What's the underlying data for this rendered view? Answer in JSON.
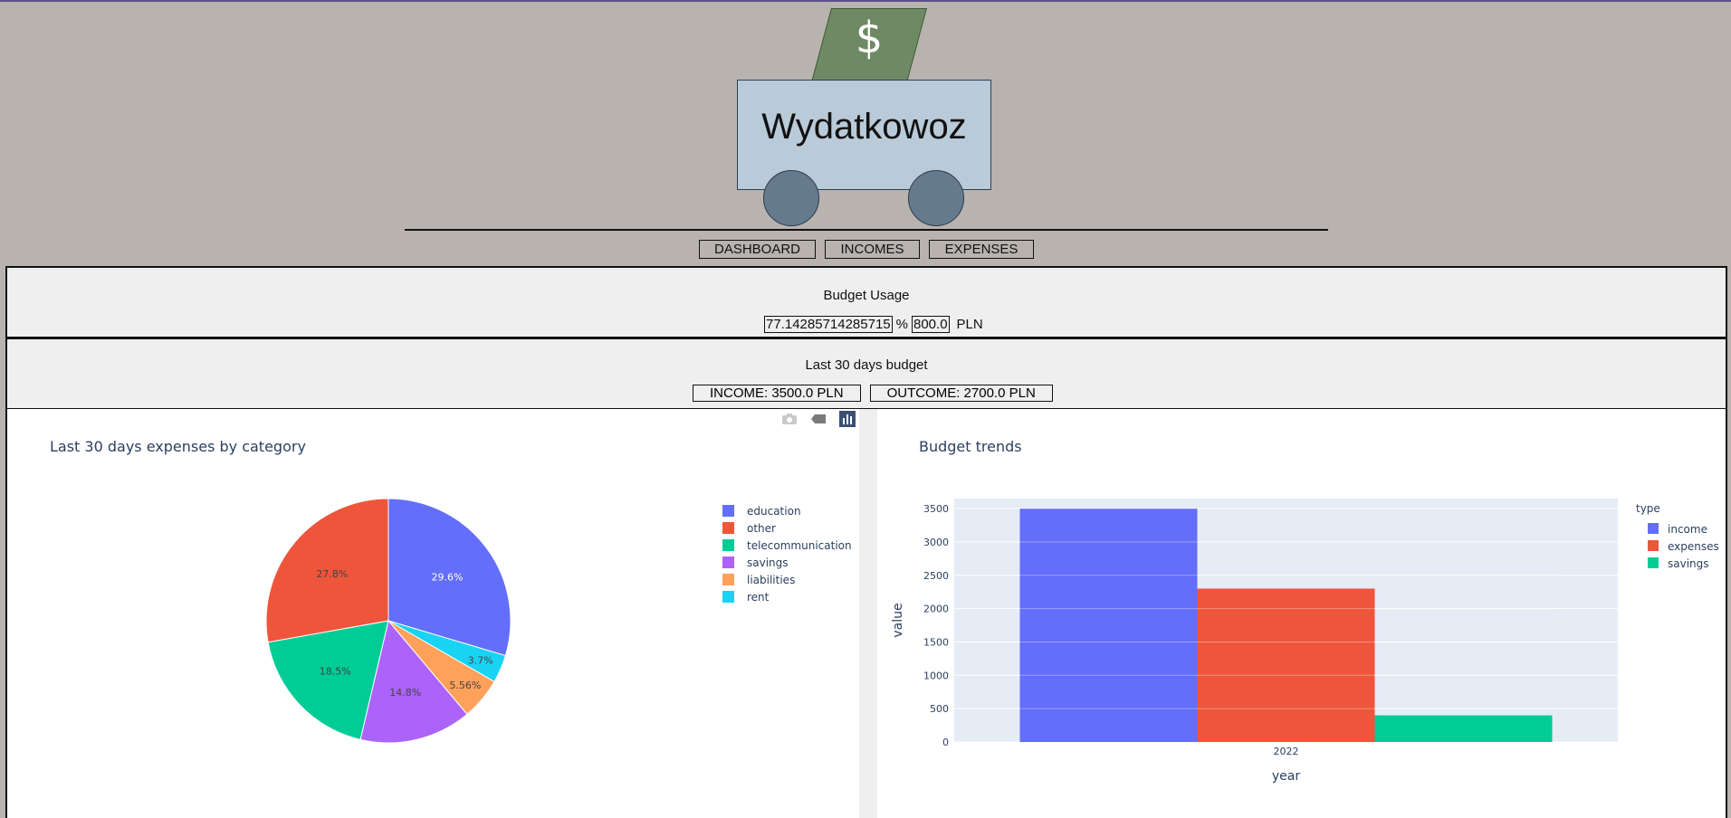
{
  "app": {
    "title": "Wydatkowoz",
    "logo_symbol": "$"
  },
  "nav": {
    "dashboard": "DASHBOARD",
    "incomes": "INCOMES",
    "expenses": "EXPENSES"
  },
  "budget_usage": {
    "title": "Budget Usage",
    "percent": "77.14285714285715",
    "percent_unit": "%",
    "amount": "800.0",
    "currency": "PLN"
  },
  "last30": {
    "title": "Last 30 days budget",
    "income": "INCOME: 3500.0 PLN",
    "outcome": "OUTCOME: 2700.0 PLN"
  },
  "modebar": {
    "icons": [
      "camera-icon",
      "tag-icon",
      "bar-chart-icon"
    ]
  },
  "chart_data": [
    {
      "type": "pie",
      "title": "Last 30 days expenses by category",
      "slices": [
        {
          "label": "education",
          "value": 29.6,
          "text": "29.6%",
          "color": "#636efa"
        },
        {
          "label": "rent",
          "value": 3.7,
          "text": "3.7%",
          "color": "#19d3f3"
        },
        {
          "label": "liabilities",
          "value": 5.56,
          "text": "5.56%",
          "color": "#ffa15a"
        },
        {
          "label": "savings",
          "value": 14.8,
          "text": "14.8%",
          "color": "#ab63fa"
        },
        {
          "label": "telecommunication",
          "value": 18.5,
          "text": "18.5%",
          "color": "#00cc96"
        },
        {
          "label": "other",
          "value": 27.8,
          "text": "27.8%",
          "color": "#ef553b"
        }
      ],
      "legend": [
        "education",
        "other",
        "telecommunication",
        "savings",
        "liabilities",
        "rent"
      ],
      "legend_placement": "top-right"
    },
    {
      "type": "bar",
      "title": "Budget trends",
      "xlabel": "year",
      "ylabel": "value",
      "categories": [
        "2022"
      ],
      "legend_title": "type",
      "series": [
        {
          "name": "income",
          "values": [
            3500
          ],
          "color": "#636efa"
        },
        {
          "name": "expenses",
          "values": [
            2300
          ],
          "color": "#ef553b"
        },
        {
          "name": "savings",
          "values": [
            400
          ],
          "color": "#00cc96"
        }
      ],
      "yticks": [
        0,
        500,
        1000,
        1500,
        2000,
        2500,
        3000,
        3500
      ],
      "ylim": [
        0,
        3650
      ],
      "grid": true,
      "legend_placement": "top-right"
    }
  ]
}
